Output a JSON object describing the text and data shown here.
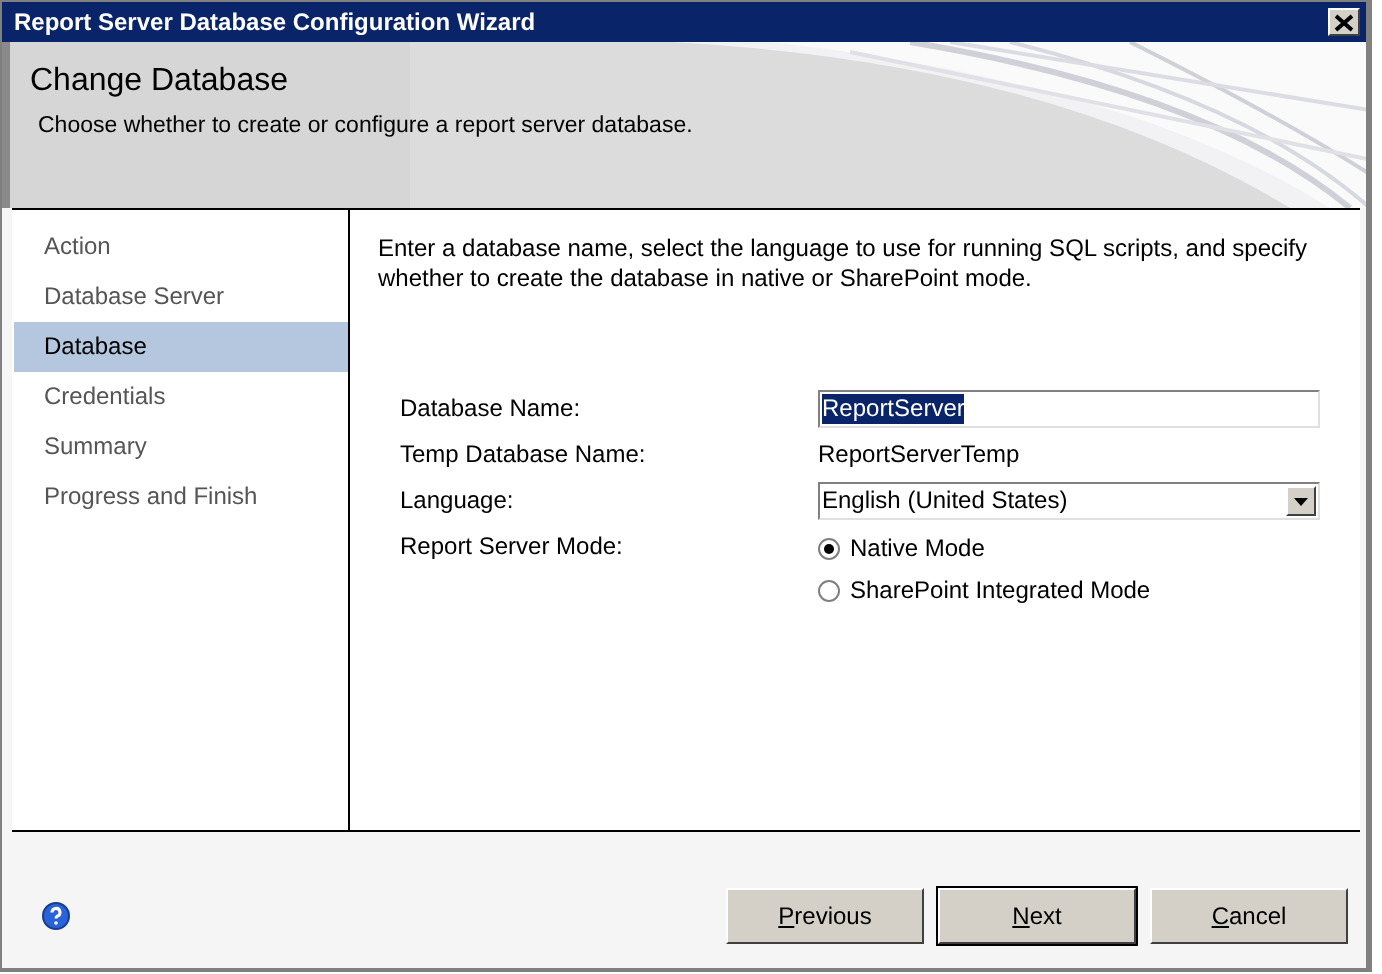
{
  "window": {
    "title": "Report Server Database Configuration Wizard"
  },
  "header": {
    "title": "Change Database",
    "subtitle": "Choose whether to create or configure a report server database."
  },
  "steps": [
    {
      "label": "Action",
      "selected": false
    },
    {
      "label": "Database Server",
      "selected": false
    },
    {
      "label": "Database",
      "selected": true
    },
    {
      "label": "Credentials",
      "selected": false
    },
    {
      "label": "Summary",
      "selected": false
    },
    {
      "label": "Progress and Finish",
      "selected": false
    }
  ],
  "instructions": "Enter a database name, select the language to use for running SQL scripts, and specify whether to create the database in native or SharePoint mode.",
  "fields": [
    {
      "kind": "text",
      "label": "Database Name:",
      "value": "ReportServer",
      "highlighted": true
    },
    {
      "kind": "readonly",
      "label": "Temp Database Name:",
      "value": "ReportServerTemp"
    },
    {
      "kind": "dropdown",
      "label": "Language:",
      "value": "English (United States)"
    },
    {
      "kind": "radio",
      "label": "Report Server Mode:",
      "options": [
        {
          "label": "Native Mode",
          "selected": true
        },
        {
          "label": "SharePoint Integrated Mode",
          "selected": false
        }
      ]
    }
  ],
  "buttons": [
    {
      "label": "Previous",
      "default": false
    },
    {
      "label": "Next",
      "default": true
    },
    {
      "label": "Cancel",
      "default": false
    }
  ]
}
